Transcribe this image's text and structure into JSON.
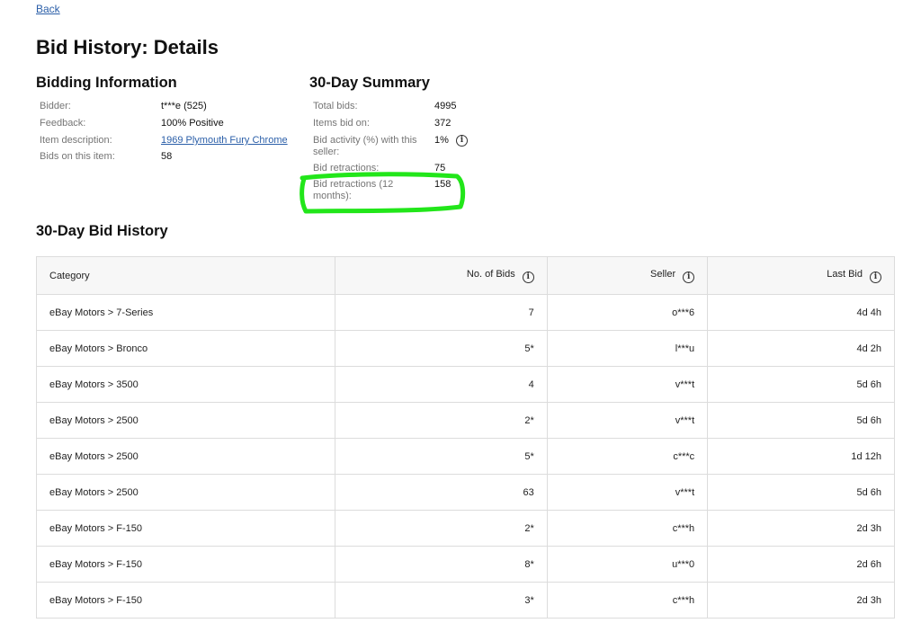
{
  "nav": {
    "back_label": "Back"
  },
  "page_title": "Bid History: Details",
  "bidding_info": {
    "heading": "Bidding Information",
    "rows": [
      {
        "label": "Bidder:",
        "value": "t***e (525)"
      },
      {
        "label": "Feedback:",
        "value": "100% Positive"
      },
      {
        "label": "Item description:",
        "value": "1969 Plymouth Fury Chrome"
      },
      {
        "label": "Bids on this item:",
        "value": "58"
      }
    ]
  },
  "summary": {
    "heading": "30-Day Summary",
    "rows": [
      {
        "label": "Total bids:",
        "value": "4995"
      },
      {
        "label": "Items bid on:",
        "value": "372"
      },
      {
        "label": "Bid activity (%) with this seller:",
        "value": "1%"
      },
      {
        "label": "Bid retractions:",
        "value": "75"
      },
      {
        "label": "Bid retractions (12 months):",
        "value": "158"
      }
    ],
    "highlight_color": "#22e61a"
  },
  "history": {
    "heading": "30-Day Bid History",
    "columns": [
      "Category",
      "No. of Bids",
      "Seller",
      "Last Bid"
    ],
    "rows": [
      {
        "category": "eBay Motors > 7-Series",
        "bids": "7",
        "seller": "o***6",
        "last_bid": "4d 4h"
      },
      {
        "category": "eBay Motors > Bronco",
        "bids": "5*",
        "seller": "l***u",
        "last_bid": "4d 2h"
      },
      {
        "category": "eBay Motors > 3500",
        "bids": "4",
        "seller": "v***t",
        "last_bid": "5d 6h"
      },
      {
        "category": "eBay Motors > 2500",
        "bids": "2*",
        "seller": "v***t",
        "last_bid": "5d 6h"
      },
      {
        "category": "eBay Motors > 2500",
        "bids": "5*",
        "seller": "c***c",
        "last_bid": "1d 12h"
      },
      {
        "category": "eBay Motors > 2500",
        "bids": "63",
        "seller": "v***t",
        "last_bid": "5d 6h"
      },
      {
        "category": "eBay Motors > F-150",
        "bids": "2*",
        "seller": "c***h",
        "last_bid": "2d 3h"
      },
      {
        "category": "eBay Motors > F-150",
        "bids": "8*",
        "seller": "u***0",
        "last_bid": "2d 6h"
      },
      {
        "category": "eBay Motors > F-150",
        "bids": "3*",
        "seller": "c***h",
        "last_bid": "2d 3h"
      }
    ]
  },
  "icons": {
    "info": "info-icon"
  }
}
